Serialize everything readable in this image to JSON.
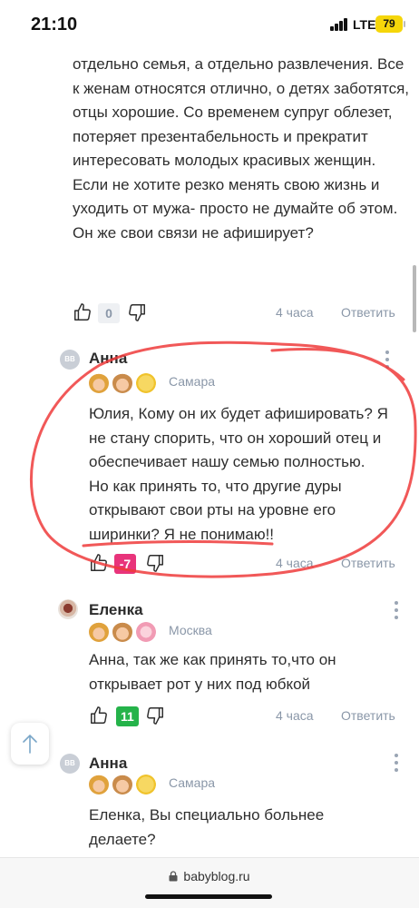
{
  "status_bar": {
    "time": "21:10",
    "network": "LTE",
    "battery": "79"
  },
  "comments": [
    {
      "text": "отдельно семья, а отдельно развлечения. Все к женам относятся отлично, о детях заботятся, отцы хорошие. Со временем супруг облезет, потеряет презентабельность и прекратит интересовать молодых красивых женщин. Если не хотите резко менять свою жизнь и уходить от мужа- просто не думайте об этом. Он же свои связи не афиширует?",
      "votes": "0",
      "time": "4 часа",
      "reply": "Ответить"
    },
    {
      "author": "Анна",
      "avatar_text": "BB",
      "city": "Самара",
      "text": "Юлия, Кому он их будет афишировать? Я не стану спорить, что он хороший отец и обеспечивает нашу семью полностью. Но как принять то, что другие дуры открывают свои рты на уровне его ширинки? Я не понимаю!!",
      "votes": "-7",
      "time": "4 часа",
      "reply": "Ответить"
    },
    {
      "author": "Еленка",
      "city": "Москва",
      "text": "Анна, так же как принять то,что он открывает рот у них под юбкой",
      "votes": "11",
      "time": "4 часа",
      "reply": "Ответить"
    },
    {
      "author": "Анна",
      "avatar_text": "BB",
      "city": "Самара",
      "text": "Еленка, Вы специально больнее делаете?"
    }
  ],
  "browser": {
    "url": "babyblog.ru"
  },
  "colors": {
    "accent_negative": "#e8347b",
    "accent_positive": "#25b34a",
    "annotation": "#ee3b3b"
  }
}
